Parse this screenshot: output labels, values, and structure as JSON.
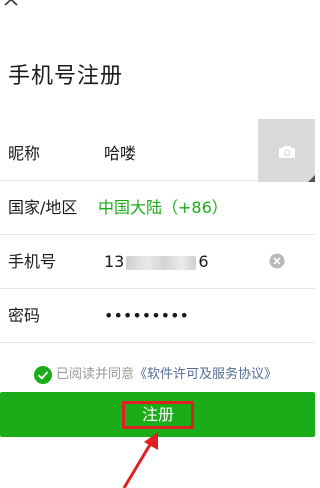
{
  "close_icon": "close-icon",
  "page_title": "手机号注册",
  "form": {
    "nickname": {
      "label": "昵称",
      "value": "哈喽"
    },
    "region": {
      "label": "国家/地区",
      "value": "中国大陆（+86）"
    },
    "phone": {
      "label": "手机号",
      "prefix": "13",
      "suffix": "6"
    },
    "password": {
      "label": "密码",
      "value": "•••••••••"
    }
  },
  "agreement": {
    "text": "已阅读并同意",
    "link": "《软件许可及服务协议》"
  },
  "register_label": "注册",
  "colors": {
    "primary": "#1aad19",
    "link": "#576b95",
    "highlight": "#e02020"
  }
}
